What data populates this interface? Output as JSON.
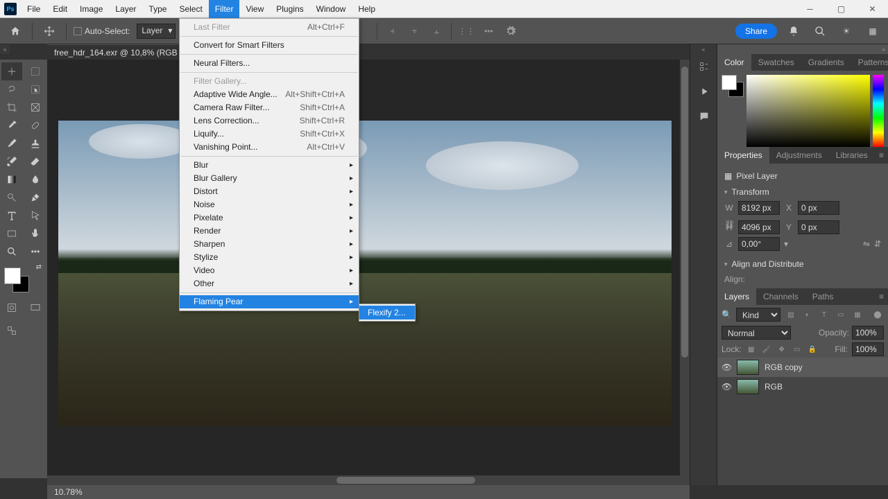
{
  "menubar": {
    "items": [
      "File",
      "Edit",
      "Image",
      "Layer",
      "Type",
      "Select",
      "Filter",
      "View",
      "Plugins",
      "Window",
      "Help"
    ],
    "active_index": 6
  },
  "optbar": {
    "auto_select": "Auto-Select:",
    "layer_mode": "Layer",
    "share": "Share"
  },
  "document": {
    "tab_title": "free_hdr_164.exr @ 10,8% (RGB c..."
  },
  "filter_menu": {
    "last_filter": {
      "label": "Last Filter",
      "shortcut": "Alt+Ctrl+F"
    },
    "convert": "Convert for Smart Filters",
    "neural": "Neural Filters...",
    "gallery": "Filter Gallery...",
    "wide_angle": {
      "label": "Adaptive Wide Angle...",
      "shortcut": "Alt+Shift+Ctrl+A"
    },
    "camera_raw": {
      "label": "Camera Raw Filter...",
      "shortcut": "Shift+Ctrl+A"
    },
    "lens": {
      "label": "Lens Correction...",
      "shortcut": "Shift+Ctrl+R"
    },
    "liquify": {
      "label": "Liquify...",
      "shortcut": "Shift+Ctrl+X"
    },
    "vanishing": {
      "label": "Vanishing Point...",
      "shortcut": "Alt+Ctrl+V"
    },
    "blur": "Blur",
    "blur_gallery": "Blur Gallery",
    "distort": "Distort",
    "noise": "Noise",
    "pixelate": "Pixelate",
    "render": "Render",
    "sharpen": "Sharpen",
    "stylize": "Stylize",
    "video": "Video",
    "other": "Other",
    "flaming_pear": "Flaming Pear"
  },
  "submenu": {
    "flexify": "Flexify 2..."
  },
  "right_panels": {
    "color_tabs": [
      "Color",
      "Swatches",
      "Gradients",
      "Patterns"
    ],
    "props_tabs": [
      "Properties",
      "Adjustments",
      "Libraries"
    ],
    "layers_tabs": [
      "Layers",
      "Channels",
      "Paths"
    ],
    "pixel_layer": "Pixel Layer",
    "transform": "Transform",
    "w_label": "W",
    "w_val": "8192 px",
    "h_label": "H",
    "h_val": "4096 px",
    "x_label": "X",
    "x_val": "0 px",
    "y_label": "Y",
    "y_val": "0 px",
    "angle": "0,00°",
    "align_distribute": "Align and Distribute",
    "align": "Align:",
    "kind": "Kind",
    "blend": "Normal",
    "opacity_label": "Opacity:",
    "opacity": "100%",
    "lock": "Lock:",
    "fill_label": "Fill:",
    "fill": "100%",
    "layers": [
      {
        "name": "RGB copy"
      },
      {
        "name": "RGB"
      }
    ]
  },
  "status": {
    "zoom": "10.78%"
  }
}
